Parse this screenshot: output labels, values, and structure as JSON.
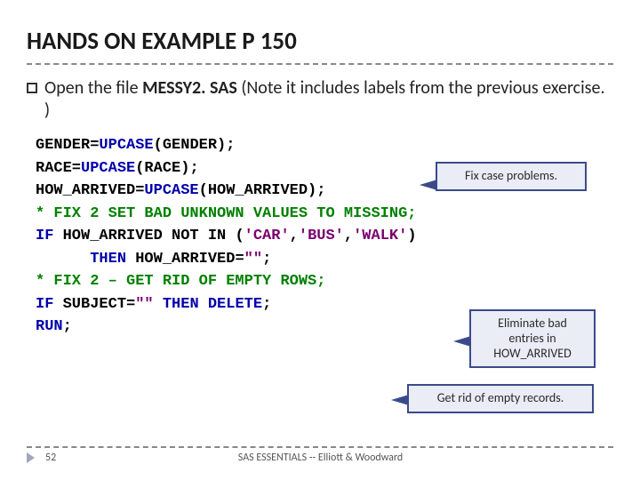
{
  "title": "HANDS ON EXAMPLE P 150",
  "bullet": {
    "prefix": "Open the file ",
    "bold": "MESSY2. SAS",
    "suffix": " (Note it includes labels from the previous exercise. )"
  },
  "code": {
    "l1a": "GENDER=",
    "l1b": "UPCASE",
    "l1c": "(GENDER);",
    "l2a": "RACE=",
    "l2b": "UPCASE",
    "l2c": "(RACE);",
    "l3a": "HOW_ARRIVED=",
    "l3b": "UPCASE",
    "l3c": "(HOW_ARRIVED);",
    "l4": "* FIX 2 SET BAD UNKNOWN VALUES TO MISSING;",
    "l5a": "IF",
    "l5b": " HOW_ARRIVED NOT IN (",
    "l5c": "'CAR'",
    "l5d": ",",
    "l5e": "'BUS'",
    "l5f": ",",
    "l5g": "'WALK'",
    "l5h": ")",
    "l6a": "      ",
    "l6b": "THEN",
    "l6c": " HOW_ARRIVED=",
    "l6d": "\"\"",
    "l6e": ";",
    "l7": "* FIX 2 – GET RID OF EMPTY ROWS;",
    "l8a": "IF",
    "l8b": " SUBJECT=",
    "l8c": "\"\"",
    "l8d": " ",
    "l8e": "THEN",
    "l8f": " ",
    "l8g": "DELETE",
    "l8h": ";",
    "l9": "RUN",
    "l9b": ";"
  },
  "callouts": {
    "c1": "Fix case problems.",
    "c2": "Eliminate bad entries in HOW_ARRIVED",
    "c3": "Get rid of empty records."
  },
  "footer": {
    "page": "52",
    "text": "SAS ESSENTIALS -- Elliott & Woodward"
  }
}
